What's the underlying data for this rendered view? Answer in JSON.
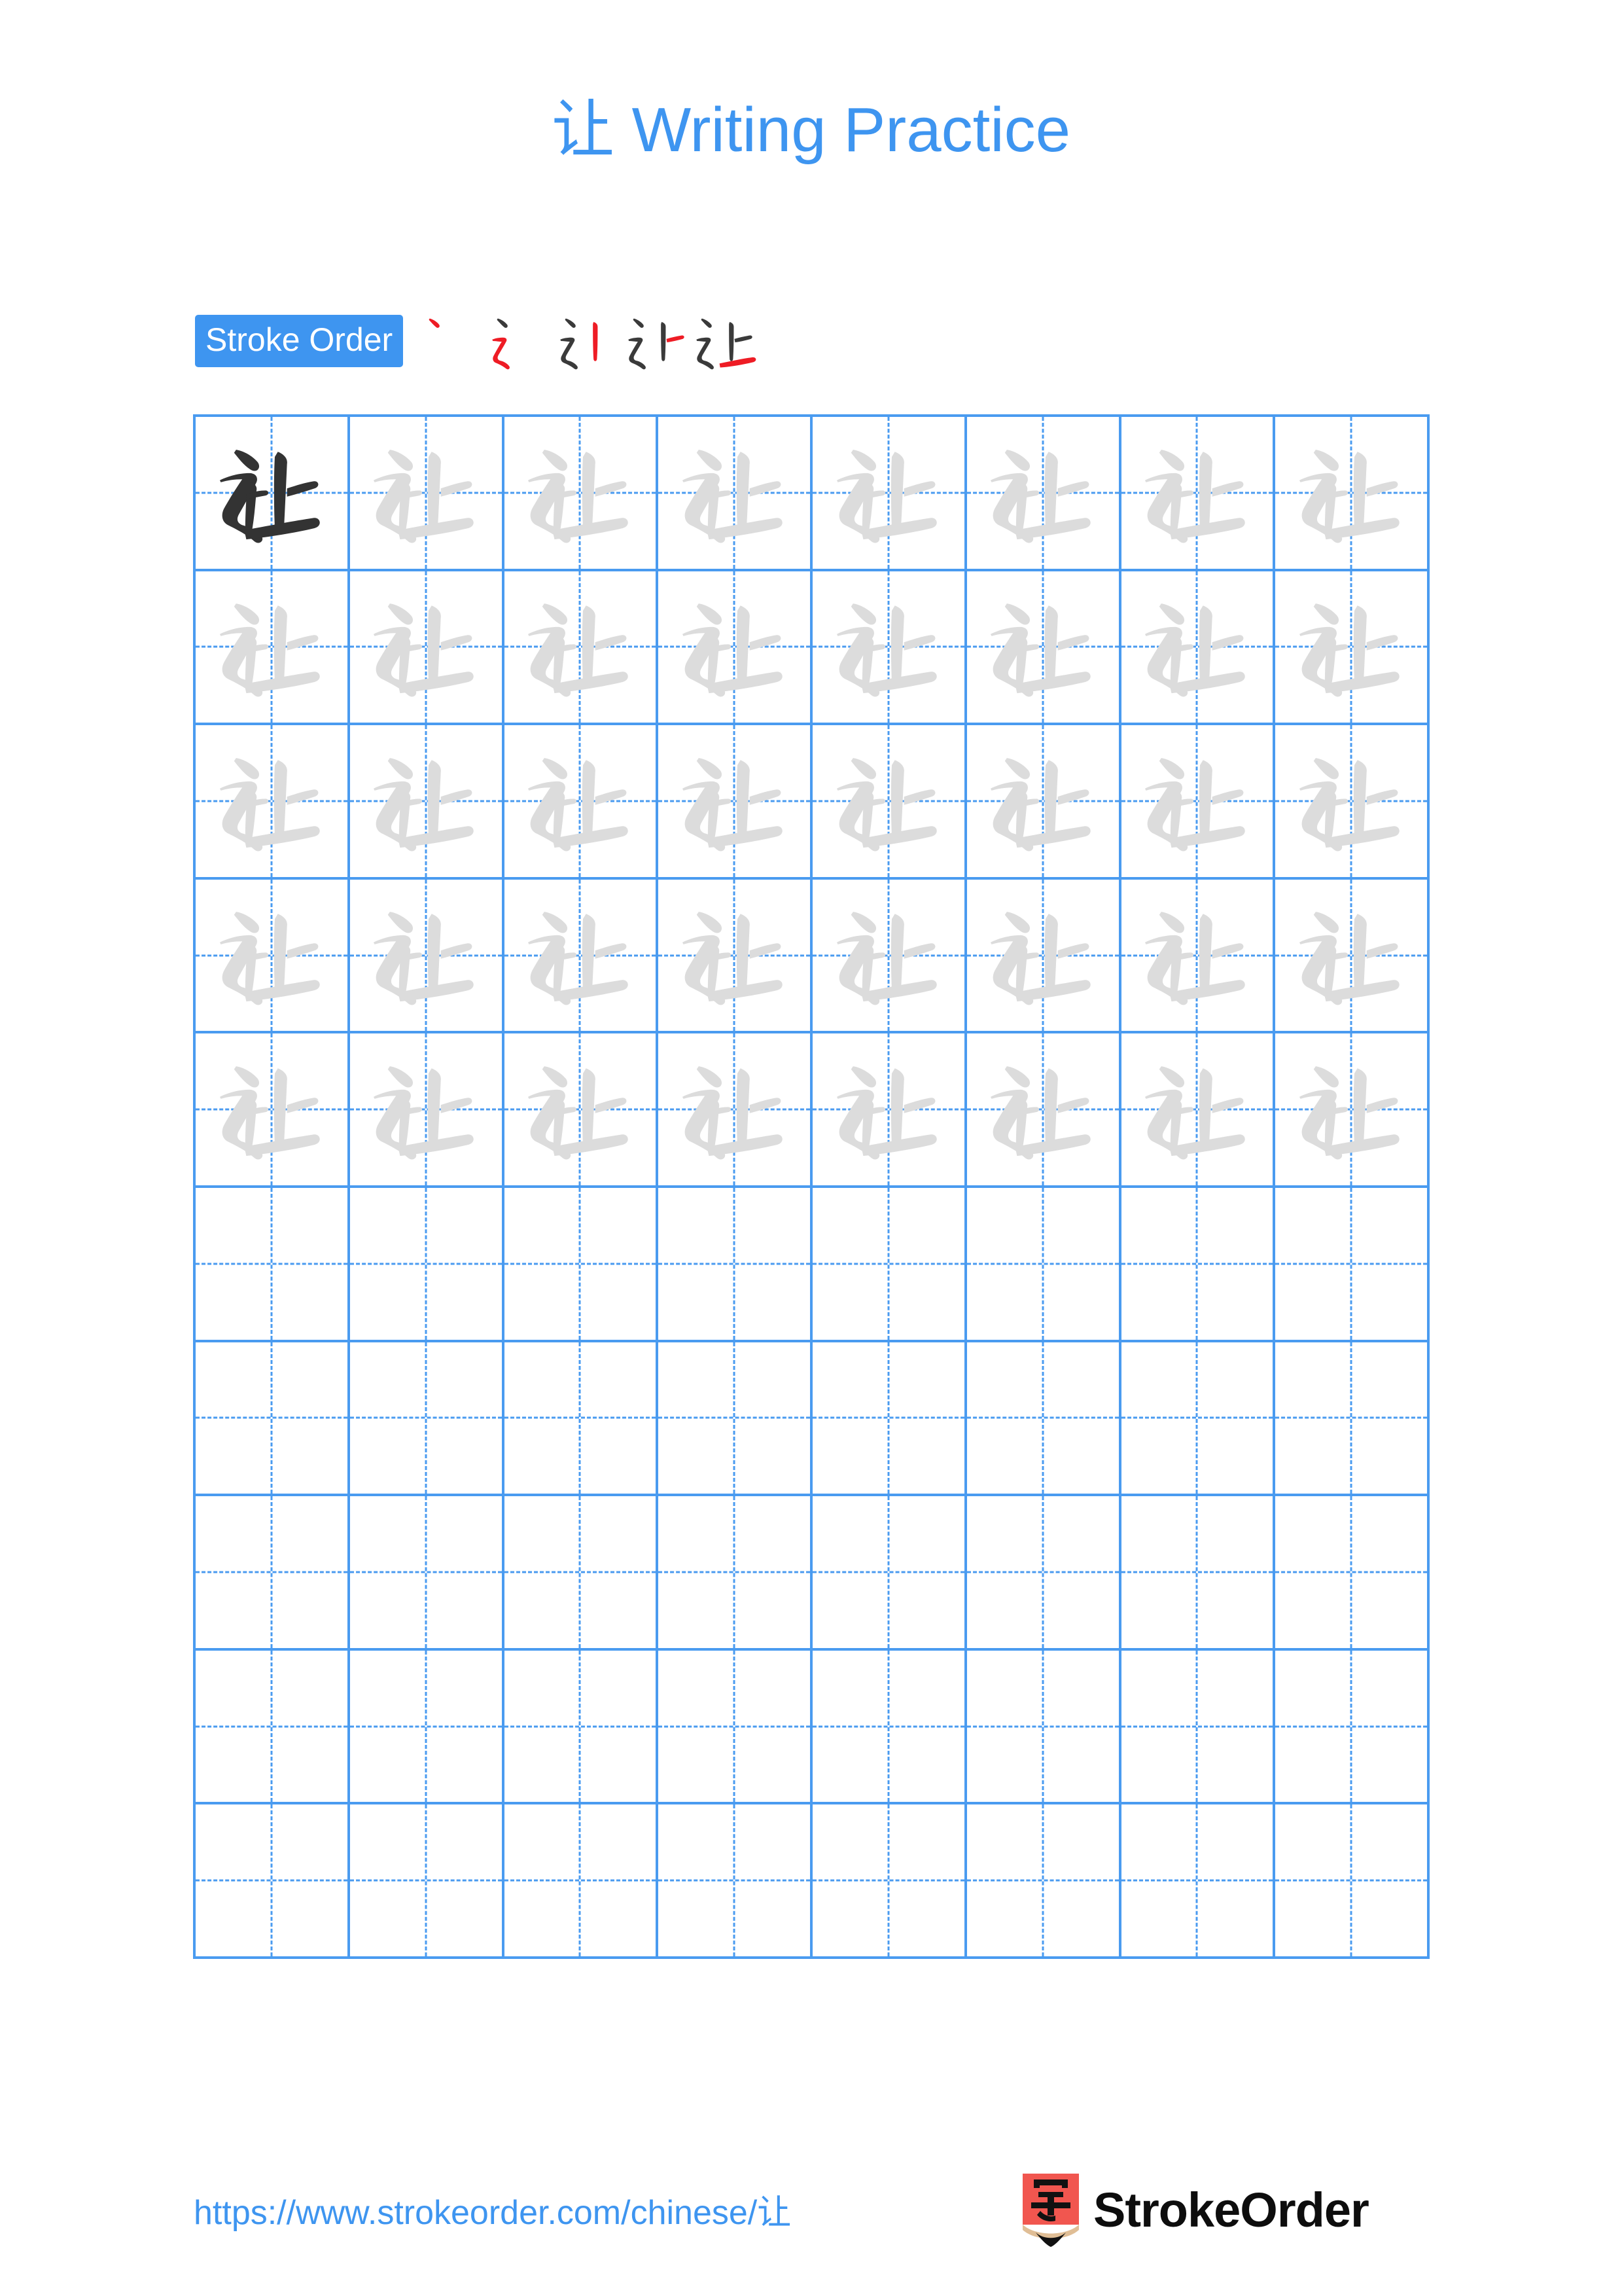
{
  "page": {
    "character": "让",
    "title": "让 Writing Practice",
    "title_prefix_character": "让",
    "title_suffix": " Writing Practice",
    "background_color": "#ffffff",
    "accent_color": "#3E95F0",
    "grid_line_color": "#4A9BF0",
    "stroke_new_color": "#EE1C25",
    "stroke_done_color": "#3A3A3A",
    "trace_color": "#DCDCDC",
    "model_color": "#333333"
  },
  "stroke_order": {
    "badge_label": "Stroke Order",
    "stroke_count": 5,
    "steps": [
      {
        "index": 1,
        "strokes_shown": 1,
        "new_stroke_index": 1,
        "label": "step-1"
      },
      {
        "index": 2,
        "strokes_shown": 2,
        "new_stroke_index": 2,
        "label": "step-2"
      },
      {
        "index": 3,
        "strokes_shown": 3,
        "new_stroke_index": 3,
        "label": "step-3"
      },
      {
        "index": 4,
        "strokes_shown": 4,
        "new_stroke_index": 4,
        "label": "step-4"
      },
      {
        "index": 5,
        "strokes_shown": 5,
        "new_stroke_index": 5,
        "label": "step-5"
      }
    ]
  },
  "grid": {
    "columns": 8,
    "rows": 10,
    "cells": [
      [
        "model",
        "trace",
        "trace",
        "trace",
        "trace",
        "trace",
        "trace",
        "trace"
      ],
      [
        "trace",
        "trace",
        "trace",
        "trace",
        "trace",
        "trace",
        "trace",
        "trace"
      ],
      [
        "trace",
        "trace",
        "trace",
        "trace",
        "trace",
        "trace",
        "trace",
        "trace"
      ],
      [
        "trace",
        "trace",
        "trace",
        "trace",
        "trace",
        "trace",
        "trace",
        "trace"
      ],
      [
        "trace",
        "trace",
        "trace",
        "trace",
        "trace",
        "trace",
        "trace",
        "trace"
      ],
      [
        "empty",
        "empty",
        "empty",
        "empty",
        "empty",
        "empty",
        "empty",
        "empty"
      ],
      [
        "empty",
        "empty",
        "empty",
        "empty",
        "empty",
        "empty",
        "empty",
        "empty"
      ],
      [
        "empty",
        "empty",
        "empty",
        "empty",
        "empty",
        "empty",
        "empty",
        "empty"
      ],
      [
        "empty",
        "empty",
        "empty",
        "empty",
        "empty",
        "empty",
        "empty",
        "empty"
      ],
      [
        "empty",
        "empty",
        "empty",
        "empty",
        "empty",
        "empty",
        "empty",
        "empty"
      ]
    ]
  },
  "footer": {
    "url": "https://www.strokeorder.com/chinese/让",
    "url_prefix": "https://www.strokeorder.com/chinese/",
    "url_character": "让",
    "logo_wordmark": "StrokeOrder",
    "logo_glyph": "字",
    "logo_body_color": "#F1564F",
    "logo_tip_color": "#E0BE96",
    "logo_point_color": "#111111"
  }
}
